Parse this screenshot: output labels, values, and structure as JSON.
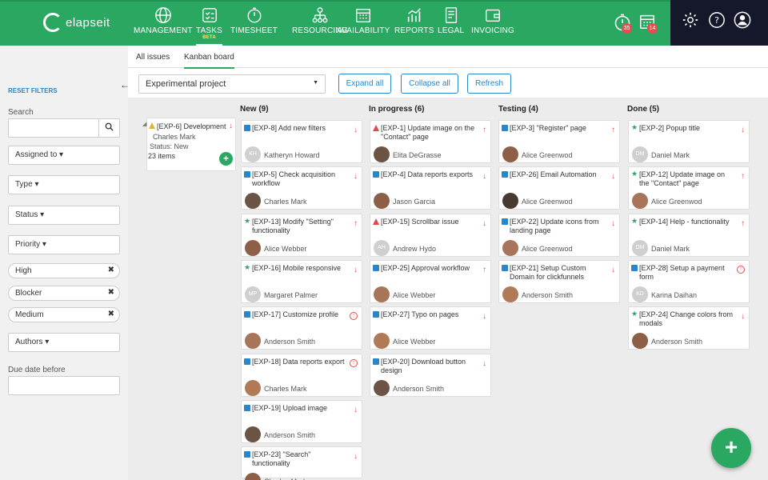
{
  "app": {
    "logo_text": "elapseit"
  },
  "nav": [
    {
      "label": "MANAGEMENT",
      "icon": "globe-icon"
    },
    {
      "label": "TASKS",
      "icon": "checklist-icon",
      "badge": "BETA"
    },
    {
      "label": "TIMESHEET",
      "icon": "stopwatch-icon"
    },
    {
      "label": "RESOURCING",
      "icon": "org-chart-icon"
    },
    {
      "label": "AVAILABILITY",
      "icon": "calendar-grid-icon"
    },
    {
      "label": "REPORTS",
      "icon": "chart-icon"
    },
    {
      "label": "LEGAL",
      "icon": "document-icon"
    },
    {
      "label": "INVOICING",
      "icon": "wallet-icon"
    }
  ],
  "header_right": {
    "timer_badge": "35",
    "calendar_badge": "14"
  },
  "sidebar": {
    "reset": "RESET FILTERS",
    "search_label": "Search",
    "assigned_to": "Assigned to",
    "type": "Type",
    "status": "Status",
    "priority": "Priority",
    "chips": [
      "High",
      "Blocker",
      "Medium"
    ],
    "authors": "Authors",
    "due_label": "Due date before"
  },
  "tabs": [
    "All issues",
    "Kanban board"
  ],
  "toolbar": {
    "project": "Experimental project",
    "expand": "Expand all",
    "collapse": "Collapse all",
    "refresh": "Refresh"
  },
  "group": {
    "title": "[EXP-6] Development",
    "person": "Charles Mark",
    "status": "Status: New",
    "count": "23 items"
  },
  "columns": [
    {
      "title": "New (9)",
      "cards": [
        {
          "id": "[EXP-8] Add new filters",
          "name": "Katheryn Howard",
          "initials": "KH",
          "type": "story",
          "prio": "down"
        },
        {
          "id": "[EXP-5] Check acquisition workflow",
          "name": "Charles Mark",
          "initials": "",
          "type": "story",
          "prio": "down"
        },
        {
          "id": "[EXP-13] Modify \"Setting\" functionality",
          "name": "Alice Webber",
          "initials": "",
          "type": "star",
          "prio": "up"
        },
        {
          "id": "[EXP-16] Mobile responsive",
          "name": "Margaret Palmer",
          "initials": "MP",
          "type": "star",
          "prio": "down"
        },
        {
          "id": "[EXP-17] Customize profile",
          "name": "Anderson Smith",
          "initials": "",
          "type": "story",
          "prio": "blocker"
        },
        {
          "id": "[EXP-18] Data reports export",
          "name": "Charles Mark",
          "initials": "",
          "type": "story",
          "prio": "blocker"
        },
        {
          "id": "[EXP-19] Upload image",
          "name": "Anderson Smith",
          "initials": "",
          "type": "story",
          "prio": "down"
        },
        {
          "id": "[EXP-23] \"Search\" functionality",
          "name": "Charles Mark",
          "initials": "",
          "type": "story",
          "prio": "down"
        }
      ]
    },
    {
      "title": "In progress (6)",
      "cards": [
        {
          "id": "[EXP-1] Update image on the \"Contact\" page",
          "name": "Elita DeGrasse",
          "initials": "",
          "type": "warn",
          "prio": "up"
        },
        {
          "id": "[EXP-4] Data reports exports",
          "name": "Jason Garcia",
          "initials": "",
          "type": "story",
          "prio": "down"
        },
        {
          "id": "[EXP-15] Scrollbar issue",
          "name": "Andrew Hydo",
          "initials": "AH",
          "type": "warn",
          "prio": "down"
        },
        {
          "id": "[EXP-25] Approval workflow",
          "name": "Alice Webber",
          "initials": "",
          "type": "story",
          "prio": "up"
        },
        {
          "id": "[EXP-27] Typo on pages",
          "name": "Alice Webber",
          "initials": "",
          "type": "story",
          "prio": "down"
        },
        {
          "id": "[EXP-20] Download button design",
          "name": "Anderson Smith",
          "initials": "",
          "type": "story",
          "prio": "down"
        }
      ]
    },
    {
      "title": "Testing (4)",
      "cards": [
        {
          "id": "[EXP-3] \"Register\" page",
          "name": "Alice Greenwod",
          "initials": "",
          "type": "story",
          "prio": "up"
        },
        {
          "id": "[EXP-26] Email Automation",
          "name": "Alice Greenwod",
          "initials": "",
          "type": "story",
          "prio": "down"
        },
        {
          "id": "[EXP-22] Update icons from landing page",
          "name": "Alice Greenwod",
          "initials": "",
          "type": "story",
          "prio": "down"
        },
        {
          "id": "[EXP-21] Setup Custom Domain for clickfunnels",
          "name": "Anderson Smith",
          "initials": "",
          "type": "story",
          "prio": "down"
        }
      ]
    },
    {
      "title": "Done (5)",
      "cards": [
        {
          "id": "[EXP-2] Popup title",
          "name": "Daniel Mark",
          "initials": "DM",
          "type": "star",
          "prio": "down"
        },
        {
          "id": "[EXP-12] Update image on the \"Contact\" page",
          "name": "Alice Greenwod",
          "initials": "",
          "type": "star",
          "prio": "up"
        },
        {
          "id": "[EXP-14] Help - functionality",
          "name": "Daniel Mark",
          "initials": "DM",
          "type": "star",
          "prio": "up"
        },
        {
          "id": "[EXP-28] Setup a payment form",
          "name": "Karina Daihan",
          "initials": "KD",
          "type": "story",
          "prio": "blocker"
        },
        {
          "id": "[EXP-24] Change colors from modals",
          "name": "Anderson Smith",
          "initials": "",
          "type": "star",
          "prio": "down"
        }
      ]
    }
  ]
}
